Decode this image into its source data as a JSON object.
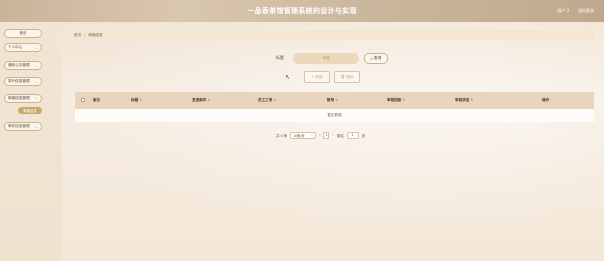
{
  "header": {
    "title": "一品香茶馆管理系统的设计与实现",
    "user_label": "用户 3",
    "logout_label": "退出登录"
  },
  "sidebar": {
    "items": [
      {
        "label": "首页"
      },
      {
        "label": "个人中心"
      },
      {
        "label": "通知公告管理"
      },
      {
        "label": "茶叶信息管理"
      },
      {
        "label": "邮箱信息管理"
      },
      {
        "label": "邮件信息管理"
      }
    ],
    "active_sub": "邮箱信息"
  },
  "breadcrumb": {
    "home": "首页",
    "separator": "/",
    "current": "邮箱信息"
  },
  "search": {
    "label": "标题",
    "placeholder": "标题",
    "button_label": "查询"
  },
  "actions": {
    "add_label": "新增",
    "delete_label": "删除"
  },
  "table": {
    "columns": [
      "索引",
      "标题",
      "发送邮件",
      "员工工号",
      "账号",
      "审核回复",
      "审核状态",
      "操作"
    ],
    "empty_text": "暂无数据"
  },
  "pager": {
    "total_text": "共 0 条",
    "page_size": "10条/页",
    "current_page": "1",
    "goto_prefix": "前往",
    "goto_value": "1",
    "goto_suffix": "页"
  }
}
